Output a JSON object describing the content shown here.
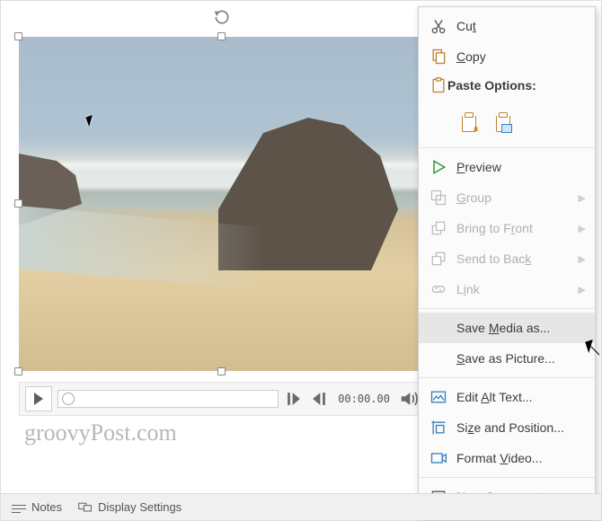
{
  "playback": {
    "time": "00:00.00"
  },
  "statusbar": {
    "notes_label": "Notes",
    "display_label": "Display Settings"
  },
  "watermark": "groovyPost.com",
  "context_menu": {
    "cut": "Cut",
    "copy": "Copy",
    "paste_header": "Paste Options:",
    "preview": "Preview",
    "group": "Group",
    "bring_front": "Bring to Front",
    "send_back": "Send to Back",
    "link": "Link",
    "save_media": "Save Media as...",
    "save_picture": "Save as Picture...",
    "edit_alt": "Edit Alt Text...",
    "size_position": "Size and Position...",
    "format_video": "Format Video...",
    "new_comment": "New Comment"
  }
}
